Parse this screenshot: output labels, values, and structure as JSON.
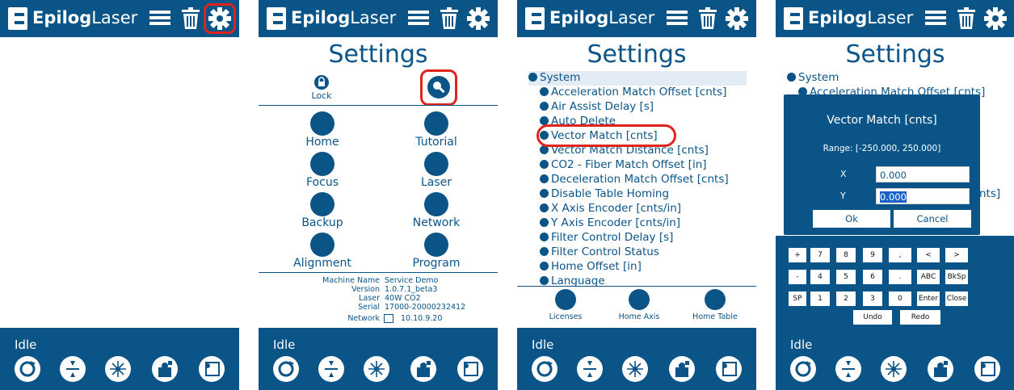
{
  "app": {
    "logo_bold": "Epilog",
    "logo_light": "Laser",
    "status": "Idle"
  },
  "colors": {
    "brand_blue": "#0a5487",
    "highlight_red": "#e0231c",
    "selection": "#1a62c7"
  },
  "icons": {
    "top": [
      "list-icon",
      "trash-icon",
      "gear-icon"
    ],
    "bottom": [
      "refresh-icon",
      "focus-icon",
      "laser-icon",
      "job-icon",
      "frame-icon"
    ]
  },
  "settings": {
    "title": "Settings",
    "lock_label": "Lock",
    "grid": [
      {
        "left": "Home",
        "right": "Tutorial"
      },
      {
        "left": "Focus",
        "right": "Laser"
      },
      {
        "left": "Backup",
        "right": "Network"
      },
      {
        "left": "Alignment",
        "right": "Program"
      }
    ],
    "machine": {
      "name_label": "Machine Name",
      "name": "Service Demo",
      "version_label": "Version",
      "version": "1.0.7.1_beta3",
      "laser_label": "Laser",
      "laser": "40W CO2",
      "serial_label": "Serial",
      "serial": "17000-20000232412",
      "network_label": "Network",
      "network": "10.10.9.20"
    }
  },
  "system_tree": {
    "root": "System",
    "items": [
      "Acceleration Match Offset [cnts]",
      "Air Assist Delay [s]",
      "Auto Delete",
      "Vector Match [cnts]",
      "Vector Match Distance [cnts]",
      "CO2 - Fiber Match Offset [in]",
      "Deceleration Match Offset [cnts]",
      "Disable Table Homing",
      "X Axis Encoder [cnts/in]",
      "Y Axis Encoder [cnts/in]",
      "Filter Control Delay [s]",
      "Filter Control Status",
      "Home Offset [in]",
      "Language"
    ],
    "footer": {
      "licenses": "Licenses",
      "home_axis": "Home Axis",
      "home_table": "Home Table"
    }
  },
  "dialog": {
    "title": "Vector Match [cnts]",
    "range": "Range: [-250.000, 250.000]",
    "x_label": "X",
    "x_value": "0.000",
    "y_label": "Y",
    "y_value": "0.000",
    "ok": "Ok",
    "cancel": "Cancel",
    "peek_root": "System",
    "peek_first": "Acceleration Match Offset [cnts]",
    "peek_frag": "nts]",
    "peek_below": "Y Axis Encoder [cnts/in]"
  },
  "keypad": {
    "row1": [
      "+",
      "7",
      "8",
      "9",
      ",",
      "<",
      ">"
    ],
    "row2": [
      "-",
      "4",
      "5",
      "6",
      ".",
      "ABC",
      "BkSp"
    ],
    "row3": [
      "SP",
      "1",
      "2",
      "3",
      "0",
      "Enter",
      "Close"
    ],
    "row4": [
      "Undo",
      "Redo"
    ]
  }
}
